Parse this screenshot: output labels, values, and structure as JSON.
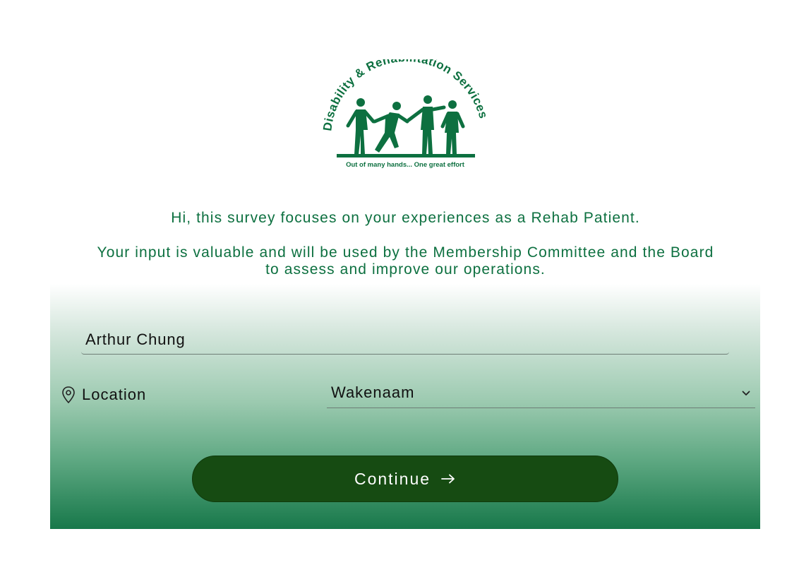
{
  "brand": {
    "logo_arc_text": "Disability & Rehabilitation Services",
    "logo_tagline": "Out of many hands... One great effort",
    "color": "#0d7040"
  },
  "intro": {
    "line1": "Hi, this survey focuses on your experiences as a Rehab Patient.",
    "line2a": "Your input is valuable and will be used by the Membership Committee and the Board",
    "line2b": "to assess and improve our operations."
  },
  "form": {
    "name_value": "Arthur Chung",
    "location_label": "Location",
    "location_icon": "map-pin-icon",
    "location_value": "Wakenaam",
    "continue_label": "Continue",
    "continue_icon": "arrow-right-icon",
    "button_color": "#164b12"
  }
}
